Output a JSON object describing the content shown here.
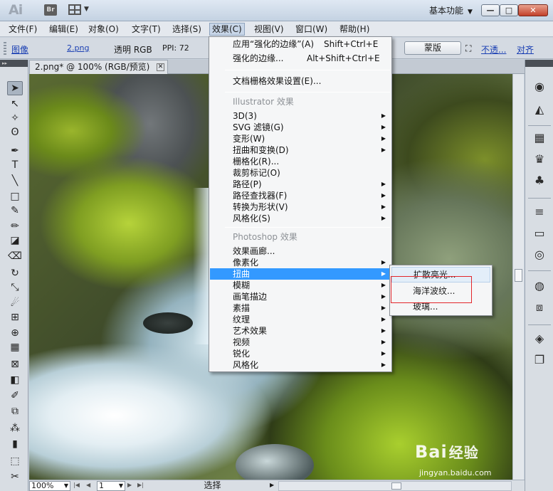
{
  "titlebar": {
    "logo": "Ai",
    "bridge_label": "Br",
    "workspace_label": "基本功能",
    "minimize": "—",
    "maximize": "□",
    "close": "✕"
  },
  "menubar": {
    "items": [
      {
        "label": "文件(F)"
      },
      {
        "label": "编辑(E)"
      },
      {
        "label": "对象(O)"
      },
      {
        "label": "文字(T)"
      },
      {
        "label": "选择(S)"
      },
      {
        "label": "效果(C)"
      },
      {
        "label": "视图(V)"
      },
      {
        "label": "窗口(W)"
      },
      {
        "label": "帮助(H)"
      }
    ]
  },
  "controlbar": {
    "type_label": "图像",
    "file_link": "2.png",
    "color_mode": "透明 RGB",
    "ppi": "PPI: 72",
    "mask_button": "蒙版",
    "opacity_link": "不透...",
    "align_link": "对齐"
  },
  "document": {
    "tab_title": "2.png* @ 100% (RGB/预览)"
  },
  "statusbar": {
    "zoom": "100%",
    "page": "1",
    "tool_status": "选择"
  },
  "effect_menu": {
    "items": [
      {
        "label": "应用“强化的边缘”(A)",
        "shortcut": "Shift+Ctrl+E"
      },
      {
        "label": "强化的边缘...",
        "shortcut": "Alt+Shift+Ctrl+E"
      },
      {
        "label": "文档栅格效果设置(E)..."
      },
      {
        "label": "Illustrator 效果"
      },
      {
        "label": "3D(3)"
      },
      {
        "label": "SVG 滤镜(G)"
      },
      {
        "label": "变形(W)"
      },
      {
        "label": "扭曲和变换(D)"
      },
      {
        "label": "栅格化(R)..."
      },
      {
        "label": "裁剪标记(O)"
      },
      {
        "label": "路径(P)"
      },
      {
        "label": "路径查找器(F)"
      },
      {
        "label": "转换为形状(V)"
      },
      {
        "label": "风格化(S)"
      },
      {
        "label": "Photoshop 效果"
      },
      {
        "label": "效果画廊..."
      },
      {
        "label": "像素化"
      },
      {
        "label": "扭曲"
      },
      {
        "label": "模糊"
      },
      {
        "label": "画笔描边"
      },
      {
        "label": "素描"
      },
      {
        "label": "纹理"
      },
      {
        "label": "艺术效果"
      },
      {
        "label": "视频"
      },
      {
        "label": "锐化"
      },
      {
        "label": "风格化"
      }
    ]
  },
  "distort_submenu": {
    "items": [
      {
        "label": "扩散亮光..."
      },
      {
        "label": "海洋波纹..."
      },
      {
        "label": "玻璃..."
      }
    ]
  },
  "watermark": {
    "brand": "Bai",
    "brand_cn": "经验",
    "url": "jingyan.baidu.com"
  },
  "colors": {
    "menu_highlight": "#3399ff",
    "annotation_red": "#e3262b"
  }
}
